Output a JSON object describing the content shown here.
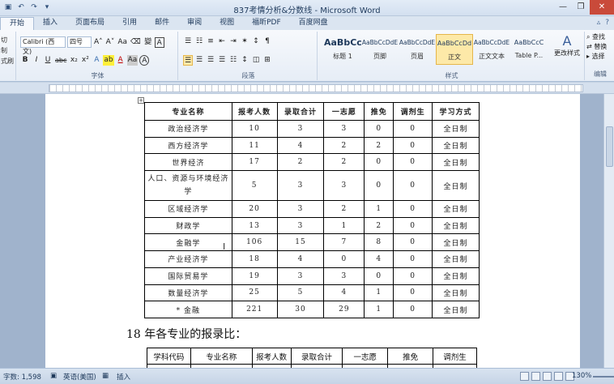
{
  "window": {
    "title": "837考情分析&分数线 - Microsoft Word",
    "quick_access": [
      "▣",
      "↶",
      "↷",
      "▾"
    ],
    "controls": [
      "—",
      "❐",
      "✕"
    ]
  },
  "tabs": [
    "开始",
    "插入",
    "页面布局",
    "引用",
    "邮件",
    "审阅",
    "视图",
    "福昕PDF",
    "百度网盘"
  ],
  "tabs_right": [
    "▵",
    "?"
  ],
  "ribbon": {
    "clipboard_items": [
      "切",
      "制",
      "式刷"
    ],
    "font_name": "Calibri (西文)",
    "font_size": "四号",
    "font_group_label": "字体",
    "paragraph_group_label": "段落",
    "styles_group_label": "样式",
    "editing_group_label": "编辑",
    "font_buttons_row1": [
      "A˄",
      "A˅",
      "Aa",
      "⌫",
      "變",
      "A"
    ],
    "font_buttons_row2": [
      "B",
      "I",
      "U",
      "abc",
      "x₂",
      "x²",
      "A",
      "ab",
      "A",
      "Aa",
      "A"
    ],
    "para_buttons_row1": [
      "☰",
      "☷",
      "≡",
      "⇤",
      "⇥",
      "✶",
      "↕",
      "¶"
    ],
    "para_buttons_row2": [
      "☰",
      "☰",
      "☰",
      "☰",
      "☷",
      "↕",
      "◫",
      "⊞"
    ],
    "styles": [
      {
        "sample": "AaBbCc",
        "name": "标题 1"
      },
      {
        "sample": "AaBbCcDdE",
        "name": "页脚"
      },
      {
        "sample": "AaBbCcDdE",
        "name": "页眉"
      },
      {
        "sample": "AaBbCcDd",
        "name": "正文"
      },
      {
        "sample": "AaBbCcDdE",
        "name": "正文文本"
      },
      {
        "sample": "AaBbCcC",
        "name": "Table P..."
      }
    ],
    "change_styles": "更改样式",
    "editing": [
      "查找",
      "替换",
      "选择"
    ]
  },
  "table1": {
    "headers": [
      "专业名称",
      "报考人数",
      "录取合计",
      "一志愿",
      "推免",
      "调剂生",
      "学习方式"
    ],
    "rows": [
      [
        "政治经济学",
        "10",
        "3",
        "3",
        "0",
        "0",
        "全日制"
      ],
      [
        "西方经济学",
        "11",
        "4",
        "2",
        "2",
        "0",
        "全日制"
      ],
      [
        "世界经济",
        "17",
        "2",
        "2",
        "0",
        "0",
        "全日制"
      ],
      [
        "人口、资源与环境经济学",
        "5",
        "3",
        "3",
        "0",
        "0",
        "全日制"
      ],
      [
        "区域经济学",
        "20",
        "3",
        "2",
        "1",
        "0",
        "全日制"
      ],
      [
        "财政学",
        "13",
        "3",
        "1",
        "2",
        "0",
        "全日制"
      ],
      [
        "金融学",
        "106",
        "15",
        "7",
        "8",
        "0",
        "全日制"
      ],
      [
        "产业经济学",
        "18",
        "4",
        "0",
        "4",
        "0",
        "全日制"
      ],
      [
        "国际贸易学",
        "19",
        "3",
        "3",
        "0",
        "0",
        "全日制"
      ],
      [
        "数量经济学",
        "25",
        "5",
        "4",
        "1",
        "0",
        "全日制"
      ],
      [
        "* 金融",
        "221",
        "30",
        "29",
        "1",
        "0",
        "全日制"
      ]
    ]
  },
  "heading2": "18 年各专业的报录比：",
  "table2": {
    "headers": [
      "学科代码",
      "专业名称",
      "报考人数",
      "录取合计",
      "一志愿",
      "推免",
      "调剂生"
    ]
  },
  "status": {
    "word_count": "字数: 1,598",
    "language": "英语(美国)",
    "mode": "插入",
    "zoom": "130%"
  }
}
